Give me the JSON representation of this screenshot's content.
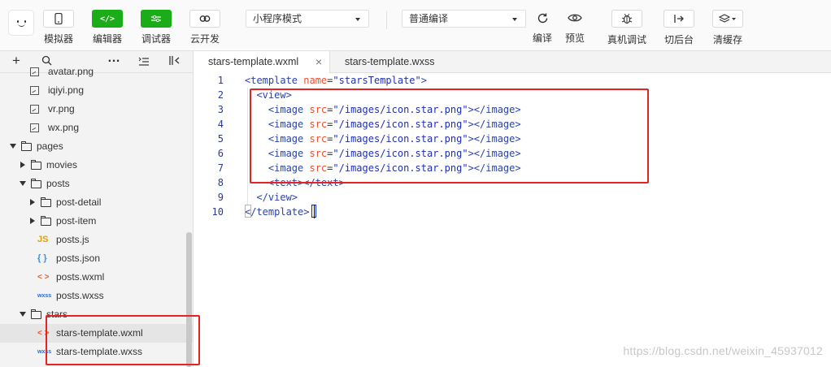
{
  "toolbar": {
    "simulator_label": "模拟器",
    "editor_label": "编辑器",
    "debugger_label": "调试器",
    "cloud_label": "云开发",
    "editor_icon": "</>",
    "mode_select": "小程序模式",
    "compile_select": "普通编译",
    "compile_label": "编译",
    "preview_label": "预览",
    "remote_debug_label": "真机调试",
    "background_label": "切后台",
    "clear_cache_label": "清缓存",
    "accent_color": "#1aad19"
  },
  "sidebar": {
    "tools": [
      "+",
      "search-icon",
      "…",
      "collapse-icon",
      "split-icon"
    ],
    "items": [
      {
        "label": "avatar.png",
        "type": "image",
        "depth": 3
      },
      {
        "label": "iqiyi.png",
        "type": "image",
        "depth": 3
      },
      {
        "label": "vr.png",
        "type": "image",
        "depth": 3
      },
      {
        "label": "wx.png",
        "type": "image",
        "depth": 3
      },
      {
        "label": "pages",
        "type": "folder-open",
        "depth": 0
      },
      {
        "label": "movies",
        "type": "folder-closed",
        "depth": 1
      },
      {
        "label": "posts",
        "type": "folder-open",
        "depth": 1
      },
      {
        "label": "post-detail",
        "type": "folder-closed",
        "depth": 2
      },
      {
        "label": "post-item",
        "type": "folder-closed",
        "depth": 2
      },
      {
        "label": "posts.js",
        "type": "js",
        "depth": 2
      },
      {
        "label": "posts.json",
        "type": "json",
        "depth": 2
      },
      {
        "label": "posts.wxml",
        "type": "wxml",
        "depth": 2
      },
      {
        "label": "posts.wxss",
        "type": "wxss",
        "depth": 2
      },
      {
        "label": "stars",
        "type": "folder-open",
        "depth": 1
      },
      {
        "label": "stars-template.wxml",
        "type": "wxml",
        "depth": 2,
        "selected": true
      },
      {
        "label": "stars-template.wxss",
        "type": "wxss",
        "depth": 2
      }
    ],
    "icon_glyphs": {
      "js": "JS",
      "json": "{ }",
      "wxml": "< >",
      "wxss": "wxss"
    }
  },
  "tabs": [
    {
      "label": "stars-template.wxml",
      "active": true,
      "close": "×"
    },
    {
      "label": "stars-template.wxss",
      "active": false
    }
  ],
  "editor": {
    "line_numbers": [
      "1",
      "2",
      "3",
      "4",
      "5",
      "6",
      "7",
      "8",
      "9",
      "10"
    ],
    "lines": [
      [
        {
          "t": "tg",
          "v": "<template "
        },
        {
          "t": "at",
          "v": "name"
        },
        {
          "t": "pl",
          "v": "="
        },
        {
          "t": "st",
          "v": "\"starsTemplate\""
        },
        {
          "t": "tg",
          "v": ">"
        }
      ],
      [
        {
          "t": "pl",
          "v": "  "
        },
        {
          "t": "tg",
          "v": "<view>"
        }
      ],
      [
        {
          "t": "pl",
          "v": "    "
        },
        {
          "t": "tg",
          "v": "<image "
        },
        {
          "t": "at",
          "v": "src"
        },
        {
          "t": "pl",
          "v": "="
        },
        {
          "t": "st",
          "v": "\"/images/icon.star.png\""
        },
        {
          "t": "tg",
          "v": "></image>"
        }
      ],
      [
        {
          "t": "pl",
          "v": "    "
        },
        {
          "t": "tg",
          "v": "<image "
        },
        {
          "t": "at",
          "v": "src"
        },
        {
          "t": "pl",
          "v": "="
        },
        {
          "t": "st",
          "v": "\"/images/icon.star.png\""
        },
        {
          "t": "tg",
          "v": "></image>"
        }
      ],
      [
        {
          "t": "pl",
          "v": "    "
        },
        {
          "t": "tg",
          "v": "<image "
        },
        {
          "t": "at",
          "v": "src"
        },
        {
          "t": "pl",
          "v": "="
        },
        {
          "t": "st",
          "v": "\"/images/icon.star.png\""
        },
        {
          "t": "tg",
          "v": "></image>"
        }
      ],
      [
        {
          "t": "pl",
          "v": "    "
        },
        {
          "t": "tg",
          "v": "<image "
        },
        {
          "t": "at",
          "v": "src"
        },
        {
          "t": "pl",
          "v": "="
        },
        {
          "t": "st",
          "v": "\"/images/icon.star.png\""
        },
        {
          "t": "tg",
          "v": "></image>"
        }
      ],
      [
        {
          "t": "pl",
          "v": "    "
        },
        {
          "t": "tg",
          "v": "<image "
        },
        {
          "t": "at",
          "v": "src"
        },
        {
          "t": "pl",
          "v": "="
        },
        {
          "t": "st",
          "v": "\"/images/icon.star.png\""
        },
        {
          "t": "tg",
          "v": "></image>"
        }
      ],
      [
        {
          "t": "pl",
          "v": "    "
        },
        {
          "t": "tg",
          "v": "<text></text>"
        }
      ],
      [
        {
          "t": "pl",
          "v": "  "
        },
        {
          "t": "tg",
          "v": "</view>"
        }
      ],
      [
        {
          "t": "tg",
          "v": "</template>"
        }
      ]
    ]
  },
  "watermark": "https://blog.csdn.net/weixin_45937012",
  "highlight_color": "#e42424"
}
